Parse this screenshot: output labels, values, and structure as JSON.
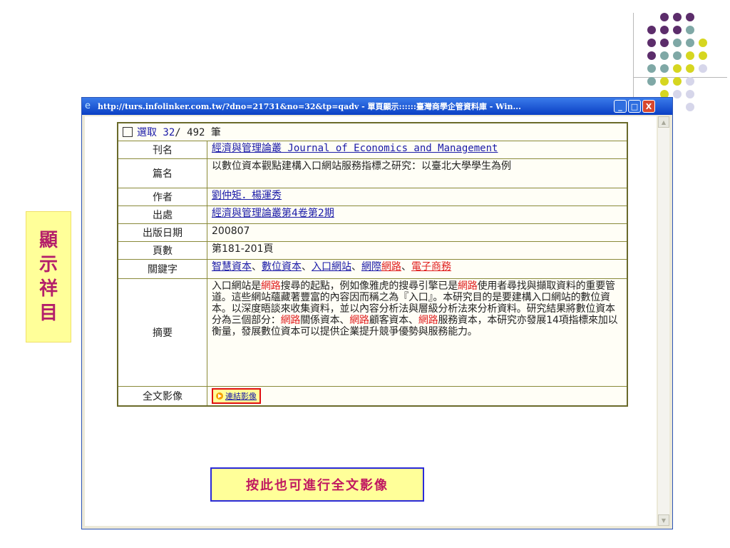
{
  "slide": {
    "side_label_chars": [
      "顯",
      "示",
      "祥",
      "目"
    ],
    "hint_text": "按此也可進行全文影像",
    "decor_colors": {
      "purple": "#5c2d6b",
      "teal": "#7fa8a6",
      "yellow": "#d6d620",
      "lilac": "#d6d6ea"
    }
  },
  "window": {
    "title": "http://turs.infolinker.com.tw/?dno=21731&no=32&tp=qadv - 單頁顯示::::::臺灣商學企管資料庫 - Win...",
    "buttons": {
      "minimize": "_",
      "maximize": "□",
      "close": "X"
    }
  },
  "record": {
    "select_label": "選取 32",
    "count_text": " / 492 筆",
    "rows": {
      "journal": {
        "label": "刊名",
        "value": "經濟與管理論叢 Journal of Economics and Management"
      },
      "title": {
        "label": "篇名",
        "value": "以數位資本觀點建構入口網站服務指標之研究：以臺北大學學生為例"
      },
      "author": {
        "label": "作者",
        "value": "劉仲矩．楊運秀"
      },
      "source": {
        "label": "出處",
        "value": "經濟與管理論叢第4卷第2期"
      },
      "date": {
        "label": "出版日期",
        "value": "200807"
      },
      "pages": {
        "label": "頁數",
        "value": "第181-201頁"
      },
      "keywords": {
        "label": "關鍵字",
        "kw1": "智慧資本",
        "sep1": "、",
        "kw2": "數位資本",
        "sep2": "、",
        "kw3": "入口網站",
        "sep3": "、",
        "kw4a": "網際",
        "kw4b": "網路",
        "sep4": "、",
        "kw5": "電子商務"
      },
      "abstract": {
        "label": "摘要",
        "p1": "入口網站是",
        "h1": "網路",
        "p2": "搜尋的起點，例如像雅虎的搜尋引擎已是",
        "h2": "網路",
        "p3": "使用者尋找與擷取資料的重要管道。這些網站蘊藏著豐富的內容因而稱之為『入口』。本研究目的是要建構入口網站的數位資本。以深度晤談來收集資料，並以內容分析法與層級分析法來分析資料。研究結果將數位資本分為三個部分：",
        "h3": "網路",
        "p4": "關係資本、",
        "h4": "網路",
        "p5": "顧客資本、",
        "h5": "網路",
        "p6": "服務資本，本研究亦發展14項指標來加以衡量，發展數位資本可以提供企業提升競爭優勢與服務能力。"
      },
      "fulltext": {
        "label": "全文影像",
        "button": "連結影像"
      }
    }
  }
}
